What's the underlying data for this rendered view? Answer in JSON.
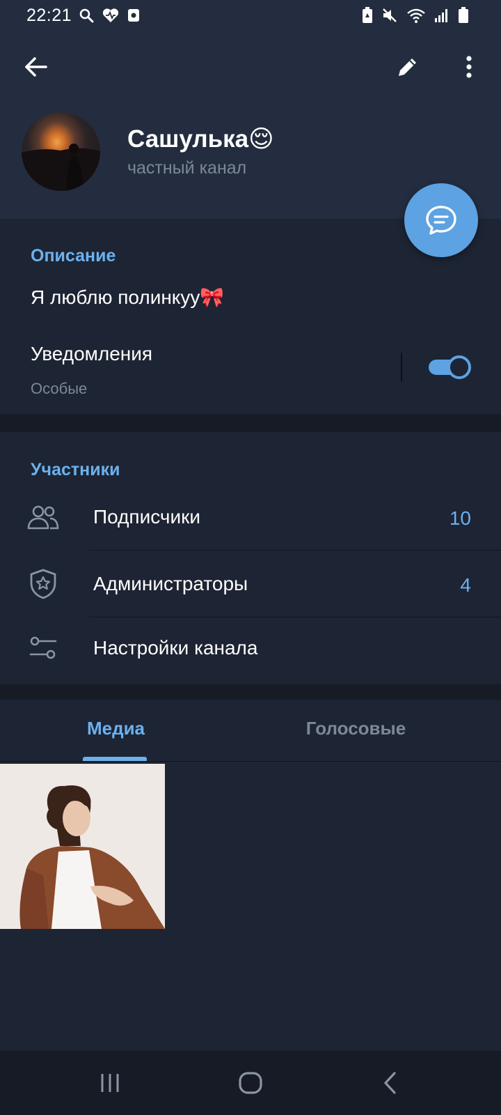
{
  "status_bar": {
    "time": "22:21",
    "left_icons": [
      "search-icon",
      "heart-icon",
      "screen-record-icon"
    ],
    "right_icons": [
      "battery-saver-icon",
      "mute-icon",
      "wifi-icon",
      "signal-icon",
      "battery-icon"
    ]
  },
  "header": {
    "title": "Сашулька😌",
    "subtitle": "частный канал"
  },
  "info": {
    "description_label": "Описание",
    "description_text": "Я люблю полинкуу🎀",
    "notifications_title": "Уведомления",
    "notifications_subtitle": "Особые",
    "notifications_enabled": true
  },
  "members": {
    "label": "Участники",
    "rows": [
      {
        "icon": "users-icon",
        "label": "Подписчики",
        "count": "10"
      },
      {
        "icon": "admin-shield-icon",
        "label": "Администраторы",
        "count": "4"
      },
      {
        "icon": "settings-sliders-icon",
        "label": "Настройки канала",
        "count": ""
      }
    ]
  },
  "tabs": [
    {
      "label": "Медиа",
      "active": true
    },
    {
      "label": "Голосовые",
      "active": false
    }
  ],
  "colors": {
    "accent": "#6cb1ee",
    "fab": "#5da2e2",
    "background": "#1d2433",
    "header": "#232d3f"
  }
}
